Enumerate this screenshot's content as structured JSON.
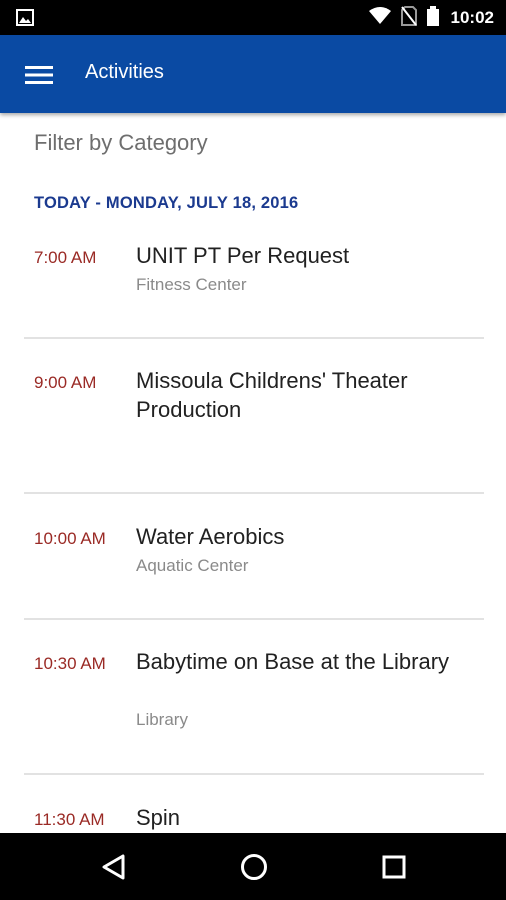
{
  "status_bar": {
    "time": "10:02",
    "icons": [
      "image-notification-icon",
      "wifi-icon",
      "no-sim-icon",
      "battery-icon"
    ]
  },
  "app_bar": {
    "title": "Activities",
    "menu_icon": "hamburger-menu-icon",
    "background_color": "#0a4aa3"
  },
  "filter": {
    "label": "Filter by Category"
  },
  "schedule": {
    "date_header": "TODAY - MONDAY, JULY 18, 2016",
    "events": [
      {
        "time": "7:00 AM",
        "title": "UNIT PT Per Request",
        "location": "Fitness Center"
      },
      {
        "time": "9:00 AM",
        "title": "Missoula Childrens' Theater Production",
        "location": ""
      },
      {
        "time": "10:00 AM",
        "title": "Water Aerobics",
        "location": "Aquatic Center"
      },
      {
        "time": "10:30 AM",
        "title": "Babytime on Base at the Library",
        "location": "Library"
      },
      {
        "time": "11:30 AM",
        "title": "Spin",
        "location": ""
      }
    ]
  },
  "nav_bar": {
    "buttons": [
      "back-icon",
      "home-icon",
      "recents-icon"
    ]
  },
  "colors": {
    "accent": "#0a4aa3",
    "date_header": "#1b3a8f",
    "time_text": "#9a2a25",
    "location_text": "#8a8a8a"
  }
}
